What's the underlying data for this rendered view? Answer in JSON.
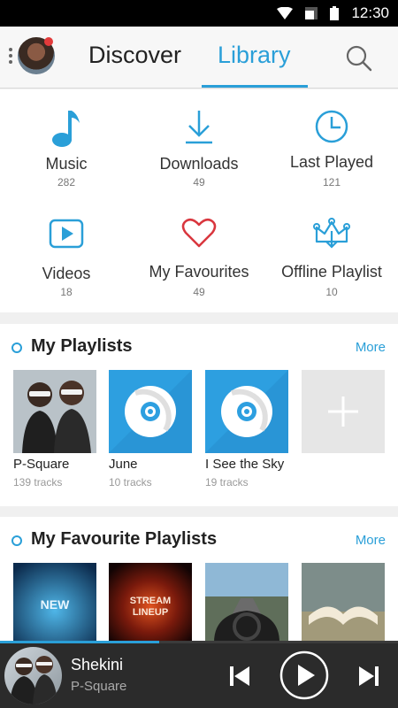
{
  "status_bar": {
    "time": "12:30"
  },
  "header": {
    "tabs": [
      {
        "label": "Discover",
        "active": false
      },
      {
        "label": "Library",
        "active": true
      }
    ]
  },
  "library": {
    "items": [
      {
        "label": "Music",
        "count": "282",
        "icon": "music-note-icon"
      },
      {
        "label": "Downloads",
        "count": "49",
        "icon": "download-icon"
      },
      {
        "label": "Last Played",
        "count": "121",
        "icon": "clock-icon"
      },
      {
        "label": "Videos",
        "count": "18",
        "icon": "video-play-icon"
      },
      {
        "label": "My Favourites",
        "count": "49",
        "icon": "heart-icon"
      },
      {
        "label": "Offline Playlist",
        "count": "10",
        "icon": "crown-download-icon"
      }
    ]
  },
  "my_playlists": {
    "title": "My Playlists",
    "more": "More",
    "items": [
      {
        "title": "P-Square",
        "tracks": "139 tracks",
        "art": "photo"
      },
      {
        "title": "June",
        "tracks": "10 tracks",
        "art": "cd"
      },
      {
        "title": "I See the Sky",
        "tracks": "19 tracks",
        "art": "cd"
      }
    ]
  },
  "favourite_playlists": {
    "title": "My  Favourite  Playlists",
    "more": "More",
    "items": [
      {
        "art_text": "NEW"
      },
      {
        "art_text": "STREAM LINEUP"
      },
      {
        "art_text": ""
      },
      {
        "art_text": ""
      }
    ]
  },
  "player": {
    "title": "Shekini",
    "artist": "P-Square",
    "progress": 0.4
  },
  "colors": {
    "accent": "#2a9fd8",
    "heart": "#d9363e",
    "player_bg": "#2b2b2b"
  }
}
